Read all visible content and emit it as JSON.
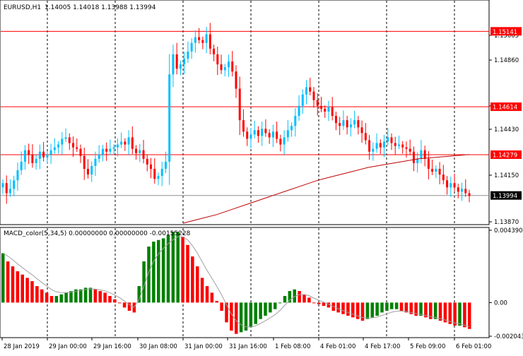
{
  "header": {
    "symbol_timeframe": "EURUSD,H1",
    "ohlc": "1.14005 1.14018 1.13988 1.13994"
  },
  "indicator_header": "MACD_color(5,34,5) 0.00000000 0.00000000 -0.00155228",
  "colors": {
    "bull_candle": "#00bfff",
    "bear_candle": "#ff0000",
    "level_line": "#ff0000",
    "ma_line": "#c00000",
    "macd_up": "#008000",
    "macd_down": "#ff0000",
    "signal_line": "#a0a0a0",
    "grid": "#000000"
  },
  "price_axis": {
    "ticks": [
      "1.15005",
      "1.14860",
      "1.14575",
      "1.14430",
      "1.14150",
      "1.13870"
    ],
    "labels_highlighted": [
      {
        "text": "1.15141",
        "type": "level"
      },
      {
        "text": "1.14614",
        "type": "level"
      },
      {
        "text": "1.14279",
        "type": "level"
      },
      {
        "text": "1.13994",
        "type": "current"
      }
    ]
  },
  "macd_axis": {
    "ticks": [
      "0.0043900",
      "0.00",
      "-0.0020430"
    ]
  },
  "time_axis": {
    "labels": [
      "28 Jan 2019",
      "29 Jan 00:00",
      "29 Jan 16:00",
      "30 Jan 08:00",
      "31 Jan 00:00",
      "31 Jan 16:00",
      "1 Feb 08:00",
      "4 Feb 01:00",
      "4 Feb 17:00",
      "5 Feb 09:00",
      "6 Feb 01:00"
    ]
  },
  "chart_data": {
    "type": "candlestick",
    "symbol": "EURUSD",
    "timeframe": "H1",
    "last_close": 1.13994,
    "horizontal_levels": [
      1.15141,
      1.14614,
      1.14279
    ],
    "price_range": [
      1.138,
      1.1535
    ],
    "closes": [
      1.1408,
      1.1401,
      1.1404,
      1.141,
      1.1417,
      1.1423,
      1.1431,
      1.1428,
      1.1422,
      1.1425,
      1.143,
      1.1426,
      1.1428,
      1.1431,
      1.1433,
      1.1435,
      1.1439,
      1.144,
      1.1436,
      1.1433,
      1.1432,
      1.1427,
      1.1418,
      1.1414,
      1.142,
      1.1425,
      1.1428,
      1.1432,
      1.143,
      1.1432,
      1.1433,
      1.1435,
      1.1437,
      1.1435,
      1.144,
      1.1432,
      1.1429,
      1.1431,
      1.1425,
      1.1421,
      1.1418,
      1.1411,
      1.1413,
      1.1418,
      1.1423,
      1.1484,
      1.1498,
      1.1488,
      1.1491,
      1.1495,
      1.15,
      1.1506,
      1.151,
      1.1508,
      1.1506,
      1.1512,
      1.1502,
      1.1498,
      1.1491,
      1.1487,
      1.1489,
      1.1493,
      1.1486,
      1.1474,
      1.1452,
      1.1444,
      1.1439,
      1.1442,
      1.1445,
      1.1441,
      1.1446,
      1.1443,
      1.144,
      1.1444,
      1.1439,
      1.1435,
      1.144,
      1.1445,
      1.1448,
      1.1455,
      1.1462,
      1.147,
      1.1475,
      1.1472,
      1.1466,
      1.1462,
      1.146,
      1.1458,
      1.1461,
      1.1455,
      1.145,
      1.1448,
      1.1452,
      1.1447,
      1.1449,
      1.1452,
      1.1447,
      1.1443,
      1.1438,
      1.143,
      1.1432,
      1.1436,
      1.1433,
      1.1437,
      1.144,
      1.1436,
      1.1434,
      1.1435,
      1.1433,
      1.1432,
      1.143,
      1.1422,
      1.1425,
      1.1431,
      1.1425,
      1.1418,
      1.1416,
      1.1418,
      1.1414,
      1.141,
      1.1405,
      1.1408,
      1.1405,
      1.1402,
      1.1404,
      1.1401,
      1.1399
    ],
    "ma_values": [
      1.138,
      1.1383,
      1.1386,
      1.139,
      1.1394,
      1.1398,
      1.1402,
      1.1406,
      1.141,
      1.1413,
      1.1416,
      1.1419,
      1.1421,
      1.1423,
      1.1425,
      1.1426,
      1.1427,
      1.1428
    ],
    "macd_histogram": [
      0.003,
      0.0025,
      0.0022,
      0.0019,
      0.0017,
      0.0015,
      0.0013,
      0.001,
      0.0008,
      0.0006,
      0.0004,
      0.0004,
      0.0005,
      0.0006,
      0.0007,
      0.0008,
      0.0008,
      0.0009,
      0.0009,
      0.0008,
      0.0007,
      0.0006,
      0.0004,
      0.0002,
      0.0,
      -0.0003,
      -0.0005,
      -0.0006,
      0.001,
      0.0025,
      0.0034,
      0.0037,
      0.0038,
      0.0039,
      0.0041,
      0.0043,
      0.0043,
      0.004,
      0.0035,
      0.0028,
      0.0022,
      0.0015,
      0.001,
      0.0006,
      0.0001,
      -0.0005,
      -0.0012,
      -0.0017,
      -0.0019,
      -0.0018,
      -0.0017,
      -0.0015,
      -0.0013,
      -0.001,
      -0.0008,
      -0.0006,
      -0.0004,
      0.0,
      0.0004,
      0.0007,
      0.0008,
      0.0007,
      0.0005,
      0.0003,
      0.0,
      -0.0001,
      -0.0002,
      -0.0003,
      -0.0005,
      -0.0006,
      -0.0007,
      -0.0008,
      -0.0009,
      -0.001,
      -0.0011,
      -0.001,
      -0.0009,
      -0.0008,
      -0.0006,
      -0.0005,
      -0.0004,
      -0.0004,
      -0.0005,
      -0.0006,
      -0.0007,
      -0.0008,
      -0.0008,
      -0.0009,
      -0.001,
      -0.001,
      -0.0011,
      -0.0012,
      -0.0013,
      -0.0014,
      -0.0014,
      -0.0015,
      -0.0016
    ]
  }
}
